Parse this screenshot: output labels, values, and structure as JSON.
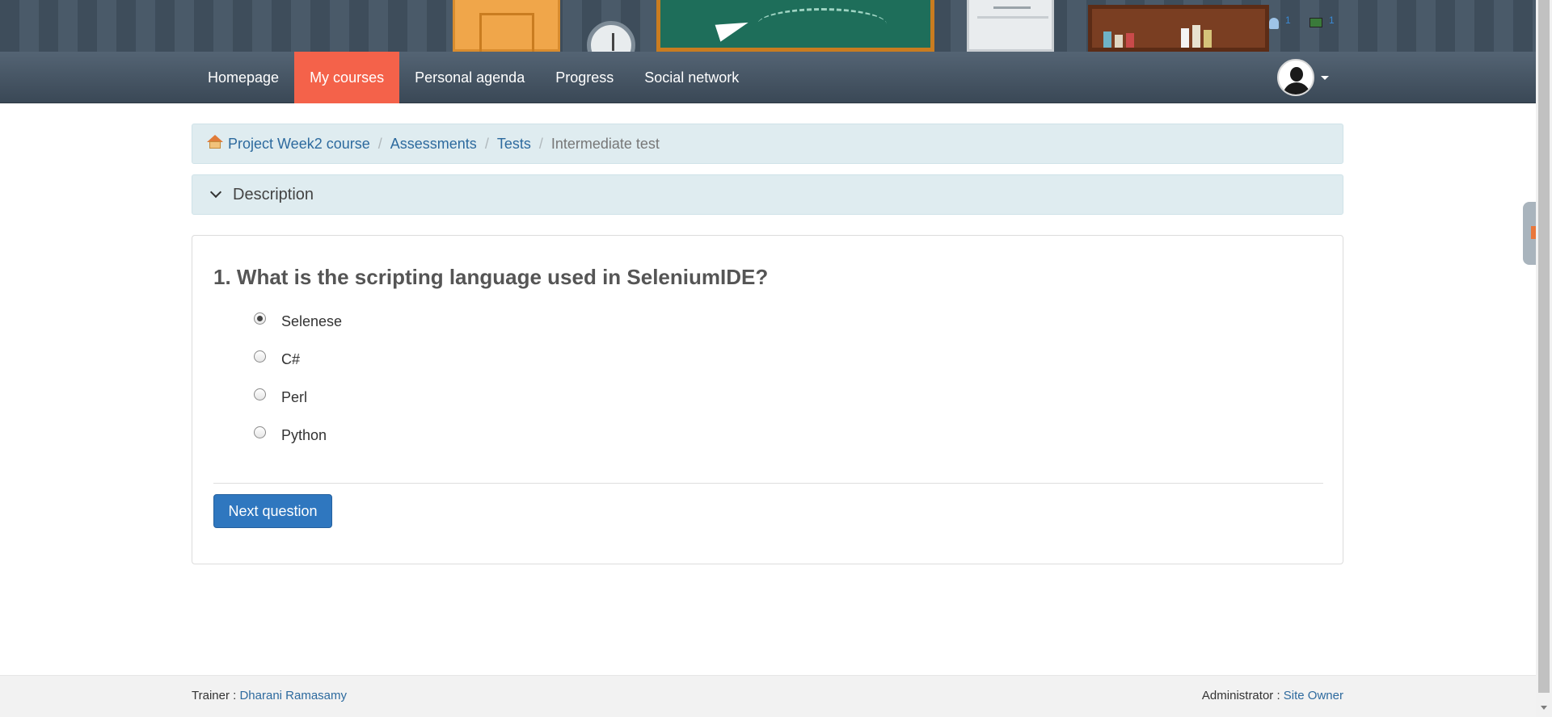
{
  "header": {
    "user_count": "1",
    "flag_count": "1"
  },
  "nav": {
    "items": [
      {
        "label": "Homepage"
      },
      {
        "label": "My courses"
      },
      {
        "label": "Personal agenda"
      },
      {
        "label": "Progress"
      },
      {
        "label": "Social network"
      }
    ],
    "active_index": 1
  },
  "breadcrumb": {
    "items": [
      {
        "label": "Project Week2 course"
      },
      {
        "label": "Assessments"
      },
      {
        "label": "Tests"
      }
    ],
    "separator": "/",
    "current": "Intermediate test"
  },
  "description": {
    "label": "Description"
  },
  "question": {
    "title": "1. What is the scripting language used in SeleniumIDE?",
    "options": [
      {
        "label": "Selenese",
        "checked": true
      },
      {
        "label": "C#",
        "checked": false
      },
      {
        "label": "Perl",
        "checked": false
      },
      {
        "label": "Python",
        "checked": false
      }
    ],
    "next_button": "Next question"
  },
  "footer": {
    "trainer_label": "Trainer :",
    "trainer_name": "Dharani Ramasamy",
    "admin_label": "Administrator :",
    "admin_name": "Site Owner"
  },
  "colors": {
    "nav_active": "#f4624a",
    "primary_button": "#2f77bf",
    "link": "#2d6a9e",
    "panel_bg": "#dfecf0"
  }
}
